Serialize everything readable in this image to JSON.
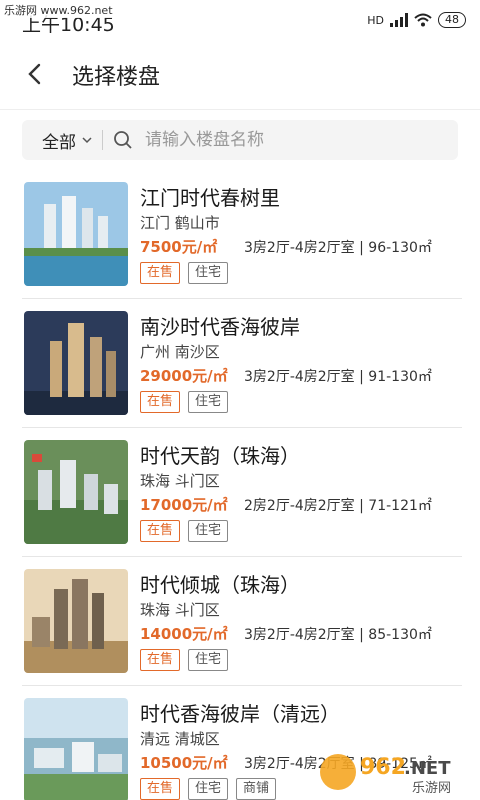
{
  "watermark_top": "乐游网 www.962.net",
  "status": {
    "time": "上午10:45",
    "network": "HD",
    "battery": "48"
  },
  "header": {
    "title": "选择楼盘"
  },
  "search": {
    "filter_label": "全部",
    "placeholder": "请输入楼盘名称"
  },
  "listings": [
    {
      "name": "江门时代春树里",
      "location": "江门 鹤山市",
      "price": "7500元/㎡",
      "rooms": "3房2厅-4房2厅室 | 96-130㎡",
      "tags": [
        "在售",
        "住宅"
      ]
    },
    {
      "name": "南沙时代香海彼岸",
      "location": "广州 南沙区",
      "price": "29000元/㎡",
      "rooms": "3房2厅-4房2厅室 | 91-130㎡",
      "tags": [
        "在售",
        "住宅"
      ]
    },
    {
      "name": "时代天韵（珠海）",
      "location": "珠海 斗门区",
      "price": "17000元/㎡",
      "rooms": "2房2厅-4房2厅室 | 71-121㎡",
      "tags": [
        "在售",
        "住宅"
      ]
    },
    {
      "name": "时代倾城（珠海）",
      "location": "珠海 斗门区",
      "price": "14000元/㎡",
      "rooms": "3房2厅-4房2厅室 | 85-130㎡",
      "tags": [
        "在售",
        "住宅"
      ]
    },
    {
      "name": "时代香海彼岸（清远）",
      "location": "清远 清城区",
      "price": "10500元/㎡",
      "rooms": "3房2厅-4房2厅室 | 89-125㎡",
      "tags": [
        "在售",
        "住宅",
        "商铺"
      ]
    }
  ],
  "watermark_bottom": {
    "brand": "962",
    "suffix": ".NET",
    "site": "乐游网"
  },
  "colors": {
    "accent": "#e2692a",
    "divider": "#e6e6e6"
  }
}
